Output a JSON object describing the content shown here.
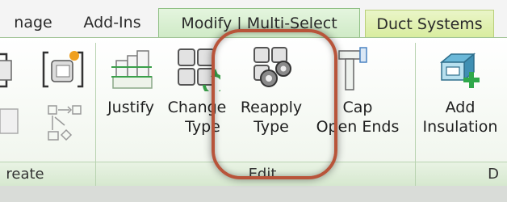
{
  "tabs": {
    "manage": "nage",
    "addins": "Add-Ins",
    "modify": "Modify | Multi-Select",
    "duct": "Duct Systems"
  },
  "buttons": {
    "justify": "Justify",
    "change_type_1": "Change",
    "change_type_2": "Type",
    "reapply_type_1": "Reapply",
    "reapply_type_2": "Type",
    "cap_open_ends_1": "Cap",
    "cap_open_ends_2": "Open Ends",
    "add_insulation_1": "Add",
    "add_insulation_2": "Insulation"
  },
  "panels": {
    "create": "reate",
    "edit": "Edit",
    "duct": "D"
  },
  "colors": {
    "accent_green": "#55b947",
    "highlight": "#b8543a"
  }
}
